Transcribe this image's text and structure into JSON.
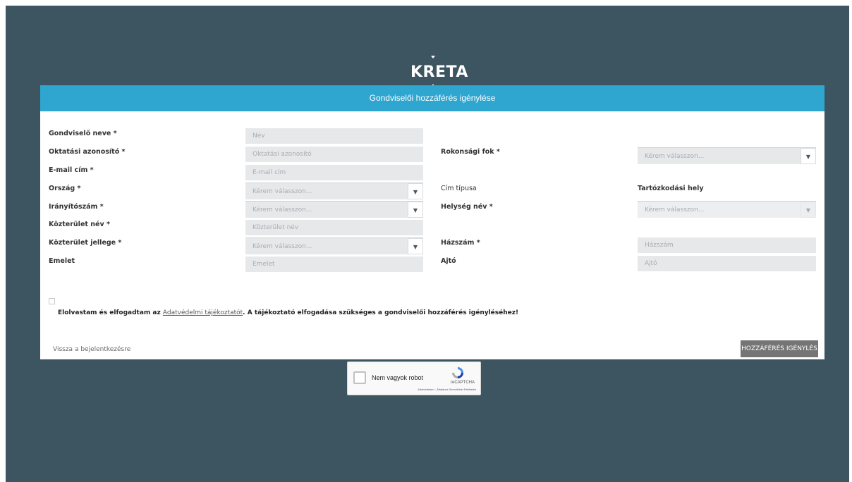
{
  "brand": {
    "logo_text": "KRETA"
  },
  "form": {
    "title": "Gondviselői hozzáférés igénylése",
    "left": {
      "gondviselo_label": "Gondviselő neve *",
      "gondviselo_placeholder": "Név",
      "oktatasi_label": "Oktatási azonosító *",
      "oktatasi_placeholder": "Oktatási azonosító",
      "email_label": "E-mail cím *",
      "email_placeholder": "E-mail cím",
      "orszag_label": "Ország *",
      "orszag_value": "Kérem válasszon...",
      "iranyito_label": "Irányítószám *",
      "iranyito_value": "Kérem válasszon...",
      "kozterulet_nev_label": "Közterület név *",
      "kozterulet_nev_placeholder": "Közterület név",
      "kozterulet_jellege_label": "Közterület jellege *",
      "kozterulet_jellege_value": "Kérem válasszon...",
      "emelet_label": "Emelet",
      "emelet_placeholder": "Emelet"
    },
    "right": {
      "rokonsagi_label": "Rokonsági fok *",
      "rokonsagi_value": "Kérem válasszon...",
      "cim_tipusa_label": "Cím típusa",
      "cim_tipusa_value": "Tartózkodási hely",
      "helyseg_label": "Helység név *",
      "helyseg_value": "Kérem válasszon...",
      "hazszam_label": "Házszám *",
      "hazszam_placeholder": "Házszám",
      "ajto_label": "Ajtó",
      "ajto_placeholder": "Ajtó"
    },
    "consent": {
      "prefix": "Elolvastam és elfogadtam az ",
      "link": "Adatvédelmi tájékoztatót",
      "suffix": ". A tájékoztató elfogadása szükséges a gondviselői hozzáférés igényléséhez!"
    },
    "back_link": "Vissza a bejelentkezésre",
    "submit_label": "HOZZÁFÉRÉS IGÉNYLÉS"
  },
  "captcha": {
    "label": "Nem vagyok robot",
    "brand": "reCAPTCHA",
    "terms": "Adatvédelem - Általános Szerződési Feltételek"
  },
  "colors": {
    "background": "#3d5561",
    "header": "#2fa6cf",
    "submit": "#757575"
  }
}
